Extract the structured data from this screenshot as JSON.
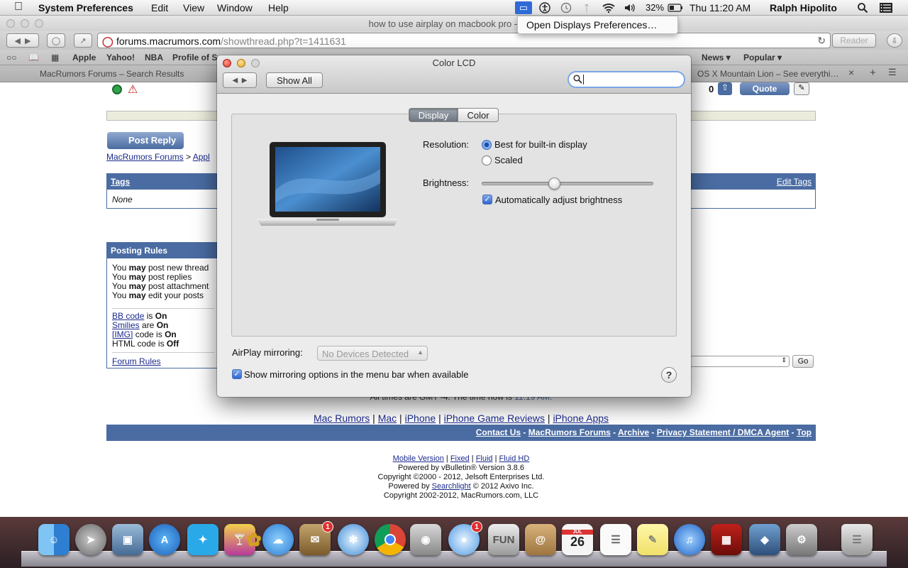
{
  "menubar": {
    "app_name": "System Preferences",
    "menus": [
      "Edit",
      "View",
      "Window",
      "Help"
    ],
    "battery": "32%",
    "clock": "Thu 11:20 AM",
    "user": "Ralph Hipolito"
  },
  "airplay_menu": {
    "item": "Open Displays Preferences…"
  },
  "browser": {
    "title": "how to use airplay on macbook pro – Mac",
    "url_host": "forums.macrumors.com",
    "url_path": "/showthread.php?t=1411631",
    "reader_label": "Reader",
    "bookmarks": [
      "Apple",
      "Yahoo!",
      "NBA",
      "Profile of S",
      "News ▾",
      "Popular ▾"
    ],
    "tabs": [
      "MacRumors Forums – Search Results",
      "OS X Mountain Lion – See everythi…"
    ]
  },
  "page": {
    "post_count": "0",
    "quote_label": "Quote",
    "post_reply_label": "Post Reply",
    "breadcrumb_root": "MacRumors Forums",
    "breadcrumb_sep": ">",
    "breadcrumb_next": "Appl",
    "tags": {
      "header": "Tags",
      "edit_link": "Edit Tags",
      "value": "None"
    },
    "posting_rules": {
      "header": "Posting Rules",
      "lines": [
        {
          "pre": "You",
          "em": "may",
          "post": "post new thread"
        },
        {
          "pre": "You",
          "em": "may",
          "post": "post replies"
        },
        {
          "pre": "You",
          "em": "may",
          "post": "post attachment"
        },
        {
          "pre": "You",
          "em": "may",
          "post": "edit your posts"
        }
      ],
      "codes": [
        {
          "link": "BB code",
          "mid": "is",
          "val": "On"
        },
        {
          "link": "Smilies",
          "mid": "are",
          "val": "On"
        },
        {
          "link": "[IMG]",
          "mid": "code is",
          "val": "On"
        },
        {
          "link": "",
          "mid": "HTML code is",
          "val": "Off"
        }
      ],
      "forum_rules": "Forum Rules"
    },
    "go_label": "Go",
    "time_note": "All times are GMT -4. The time now is",
    "time_value": "11:19 AM.",
    "bottom_links": [
      "Mac Rumors",
      "Mac",
      "iPhone",
      "iPhone Game Reviews",
      "iPhone Apps"
    ],
    "footer_links": [
      "Contact Us",
      "MacRumors Forums",
      "Archive",
      "Privacy Statement / DMCA Agent",
      "Top"
    ],
    "style_links": [
      "Mobile Version",
      "Fixed",
      "Fluid",
      "Fluid HD"
    ],
    "powered_by": "Powered by vBulletin® Version 3.8.6",
    "copyright1": "Copyright ©2000 - 2012, Jelsoft Enterprises Ltd.",
    "searchlight_pre": "Powered by",
    "searchlight_link": "Searchlight",
    "searchlight_post": "© 2012 Axivo Inc.",
    "copyright2": "Copyright 2002-2012, MacRumors.com, LLC"
  },
  "prefs": {
    "window_title": "Color LCD",
    "show_all": "Show All",
    "tabs": [
      "Display",
      "Color"
    ],
    "resolution_label": "Resolution:",
    "res_options": [
      "Best for built-in display",
      "Scaled"
    ],
    "brightness_label": "Brightness:",
    "brightness_level": 0.42,
    "auto_brightness": "Automatically adjust brightness",
    "airplay_label": "AirPlay mirroring:",
    "airplay_value": "No Devices Detected",
    "show_mirroring": "Show mirroring options in the menu bar when available",
    "help": "?"
  },
  "dock": {
    "calendar_day": "26",
    "calendar_month": "JUL",
    "badges": {
      "mail": "1",
      "messages": "1"
    },
    "apps": [
      "finder",
      "launchpad",
      "preview",
      "app-store",
      "twitter",
      "cocktail",
      "pineapple",
      "cloud",
      "mail",
      "safari",
      "chrome",
      "facetime",
      "messages",
      "disk-utility",
      "contacts",
      "calendar",
      "reminders",
      "notes",
      "itunes",
      "photo-booth",
      "iphoto",
      "system-preferences",
      "trash"
    ],
    "accent": "#2f68d3"
  }
}
